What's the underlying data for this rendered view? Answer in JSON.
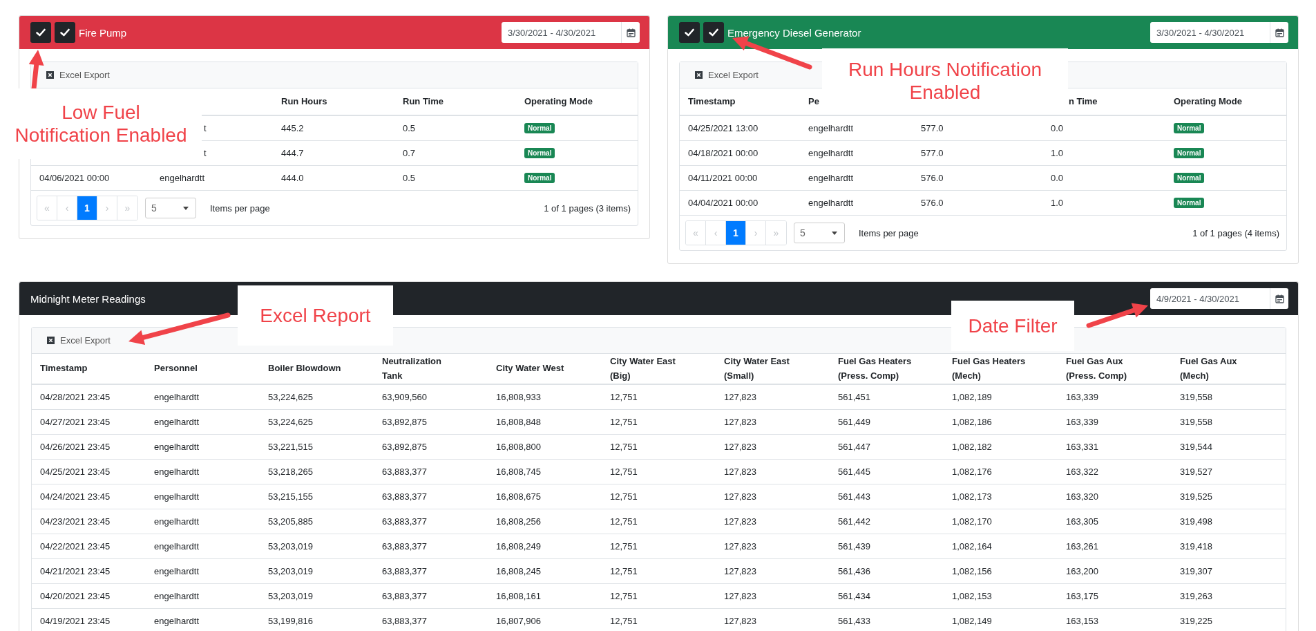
{
  "panels": [
    {
      "title": "Fire Pump",
      "color": "#dc3545",
      "toggles": [
        {
          "checked": true
        },
        {
          "checked": true
        }
      ],
      "date_range": "3/30/2021 - 4/30/2021",
      "export_label": "Excel Export",
      "columns": [
        null,
        null,
        "Run Hours",
        "Run Time",
        "Operating Mode"
      ],
      "rows": [
        {
          "cells": [
            null,
            {
              "text": "t",
              "cut": true
            },
            "445.2",
            "0.5"
          ],
          "mode": "Normal"
        },
        {
          "cells": [
            null,
            {
              "text": "t",
              "cut": true
            },
            "444.7",
            "0.7"
          ],
          "mode": "Normal"
        },
        {
          "cells": [
            "04/06/2021 00:00",
            "engelhardtt",
            "444.0",
            "0.5"
          ],
          "mode": "Normal"
        }
      ],
      "pager": {
        "buttons": [
          {
            "label": "«",
            "selected": false,
            "disabled": true
          },
          {
            "label": "‹",
            "selected": false,
            "disabled": true
          },
          {
            "label": "1",
            "selected": true,
            "disabled": false
          },
          {
            "label": "›",
            "selected": false,
            "disabled": true
          },
          {
            "label": "»",
            "selected": false,
            "disabled": true
          }
        ],
        "page_size": "5",
        "page_size_label": "Items per page",
        "summary": "1 of 1 pages (3 items)"
      }
    },
    {
      "title": "Emergency Diesel Generator",
      "color": "#198754",
      "toggles": [
        {
          "checked": true
        },
        {
          "checked": true
        }
      ],
      "date_range": "3/30/2021 - 4/30/2021",
      "export_label": "Excel Export",
      "columns": [
        "Timestamp",
        "Pe",
        null,
        {
          "text": "n Time",
          "cut": true
        },
        "Operating Mode"
      ],
      "rows": [
        {
          "cells": [
            "04/25/2021 13:00",
            "engelhardtt",
            "577.0",
            "0.0"
          ],
          "mode": "Normal"
        },
        {
          "cells": [
            "04/18/2021 00:00",
            "engelhardtt",
            "577.0",
            "1.0"
          ],
          "mode": "Normal"
        },
        {
          "cells": [
            "04/11/2021 00:00",
            "engelhardtt",
            "576.0",
            "0.0"
          ],
          "mode": "Normal"
        },
        {
          "cells": [
            "04/04/2021 00:00",
            "engelhardtt",
            "576.0",
            "1.0"
          ],
          "mode": "Normal"
        }
      ],
      "pager": {
        "buttons": [
          {
            "label": "«",
            "selected": false,
            "disabled": true
          },
          {
            "label": "‹",
            "selected": false,
            "disabled": true
          },
          {
            "label": "1",
            "selected": true,
            "disabled": false
          },
          {
            "label": "›",
            "selected": false,
            "disabled": true
          },
          {
            "label": "»",
            "selected": false,
            "disabled": true
          }
        ],
        "page_size": "5",
        "page_size_label": "Items per page",
        "summary": "1 of 1 pages (4 items)"
      }
    },
    {
      "title": "Midnight Meter Readings",
      "color": "#212529",
      "date_range": "4/9/2021 - 4/30/2021",
      "export_label": "Excel Export",
      "columns": [
        "Timestamp",
        "Personnel",
        "Boiler Blowdown",
        "Neutralization\nTank",
        "City Water West",
        "City Water East\n(Big)",
        "City Water East\n(Small)",
        "Fuel Gas Heaters\n(Press. Comp)",
        "Fuel Gas Heaters\n(Mech)",
        "Fuel Gas Aux\n(Press. Comp)",
        "Fuel Gas Aux\n(Mech)"
      ],
      "rows": [
        {
          "cells": [
            "04/28/2021 23:45",
            "engelhardtt",
            "53,224,625",
            "63,909,560",
            "16,808,933",
            "12,751",
            "127,823",
            "561,451",
            "1,082,189",
            "163,339",
            "319,558"
          ]
        },
        {
          "cells": [
            "04/27/2021 23:45",
            "engelhardtt",
            "53,224,625",
            "63,892,875",
            "16,808,848",
            "12,751",
            "127,823",
            "561,449",
            "1,082,186",
            "163,339",
            "319,558"
          ]
        },
        {
          "cells": [
            "04/26/2021 23:45",
            "engelhardtt",
            "53,221,515",
            "63,892,875",
            "16,808,800",
            "12,751",
            "127,823",
            "561,447",
            "1,082,182",
            "163,331",
            "319,544"
          ]
        },
        {
          "cells": [
            "04/25/2021 23:45",
            "engelhardtt",
            "53,218,265",
            "63,883,377",
            "16,808,745",
            "12,751",
            "127,823",
            "561,445",
            "1,082,176",
            "163,322",
            "319,527"
          ]
        },
        {
          "cells": [
            "04/24/2021 23:45",
            "engelhardtt",
            "53,215,155",
            "63,883,377",
            "16,808,675",
            "12,751",
            "127,823",
            "561,443",
            "1,082,173",
            "163,320",
            "319,525"
          ]
        },
        {
          "cells": [
            "04/23/2021 23:45",
            "engelhardtt",
            "53,205,885",
            "63,883,377",
            "16,808,256",
            "12,751",
            "127,823",
            "561,442",
            "1,082,170",
            "163,305",
            "319,498"
          ]
        },
        {
          "cells": [
            "04/22/2021 23:45",
            "engelhardtt",
            "53,203,019",
            "63,883,377",
            "16,808,249",
            "12,751",
            "127,823",
            "561,439",
            "1,082,164",
            "163,261",
            "319,418"
          ]
        },
        {
          "cells": [
            "04/21/2021 23:45",
            "engelhardtt",
            "53,203,019",
            "63,883,377",
            "16,808,245",
            "12,751",
            "127,823",
            "561,436",
            "1,082,156",
            "163,200",
            "319,307"
          ]
        },
        {
          "cells": [
            "04/20/2021 23:45",
            "engelhardtt",
            "53,203,019",
            "63,883,377",
            "16,808,161",
            "12,751",
            "127,823",
            "561,434",
            "1,082,153",
            "163,175",
            "319,263"
          ]
        },
        {
          "cells": [
            "04/19/2021 23:45",
            "engelhardtt",
            "53,199,816",
            "63,883,377",
            "16,807,906",
            "12,751",
            "127,823",
            "561,433",
            "1,082,149",
            "163,153",
            "319,225"
          ]
        }
      ]
    }
  ],
  "annotations": [
    {
      "text": "Low Fuel\nNotification Enabled"
    },
    {
      "text": "Run Hours Notification\nEnabled"
    },
    {
      "text": "Excel Report"
    },
    {
      "text": "Date Filter"
    }
  ]
}
